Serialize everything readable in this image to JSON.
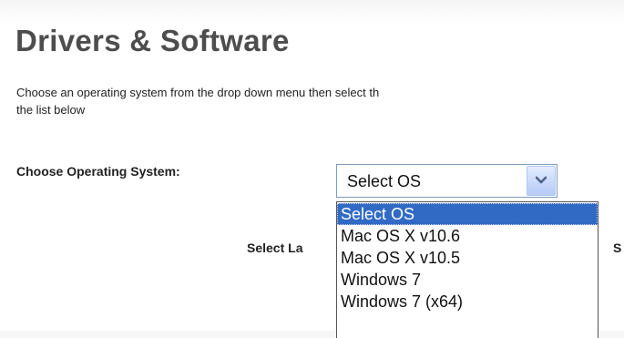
{
  "page": {
    "title": "Drivers & Software",
    "instructions": "Choose an operating system from the drop down menu then select th\nthe list below"
  },
  "os_picker": {
    "label": "Choose Operating System:",
    "selected_value": "Select OS",
    "dropdown_icon": "chevron-down-icon",
    "options": [
      {
        "label": "Select OS",
        "highlighted": true
      },
      {
        "label": "Mac OS X v10.6",
        "highlighted": false
      },
      {
        "label": "Mac OS X v10.5",
        "highlighted": false
      },
      {
        "label": "Windows 7",
        "highlighted": false
      },
      {
        "label": "Windows 7 (x64)",
        "highlighted": false
      }
    ]
  },
  "language_picker": {
    "label": "Select La"
  },
  "right_label_fragment": "S",
  "colors": {
    "highlight": "#316ac5",
    "title": "#4d4d4d",
    "select_border": "#7f9db9"
  }
}
